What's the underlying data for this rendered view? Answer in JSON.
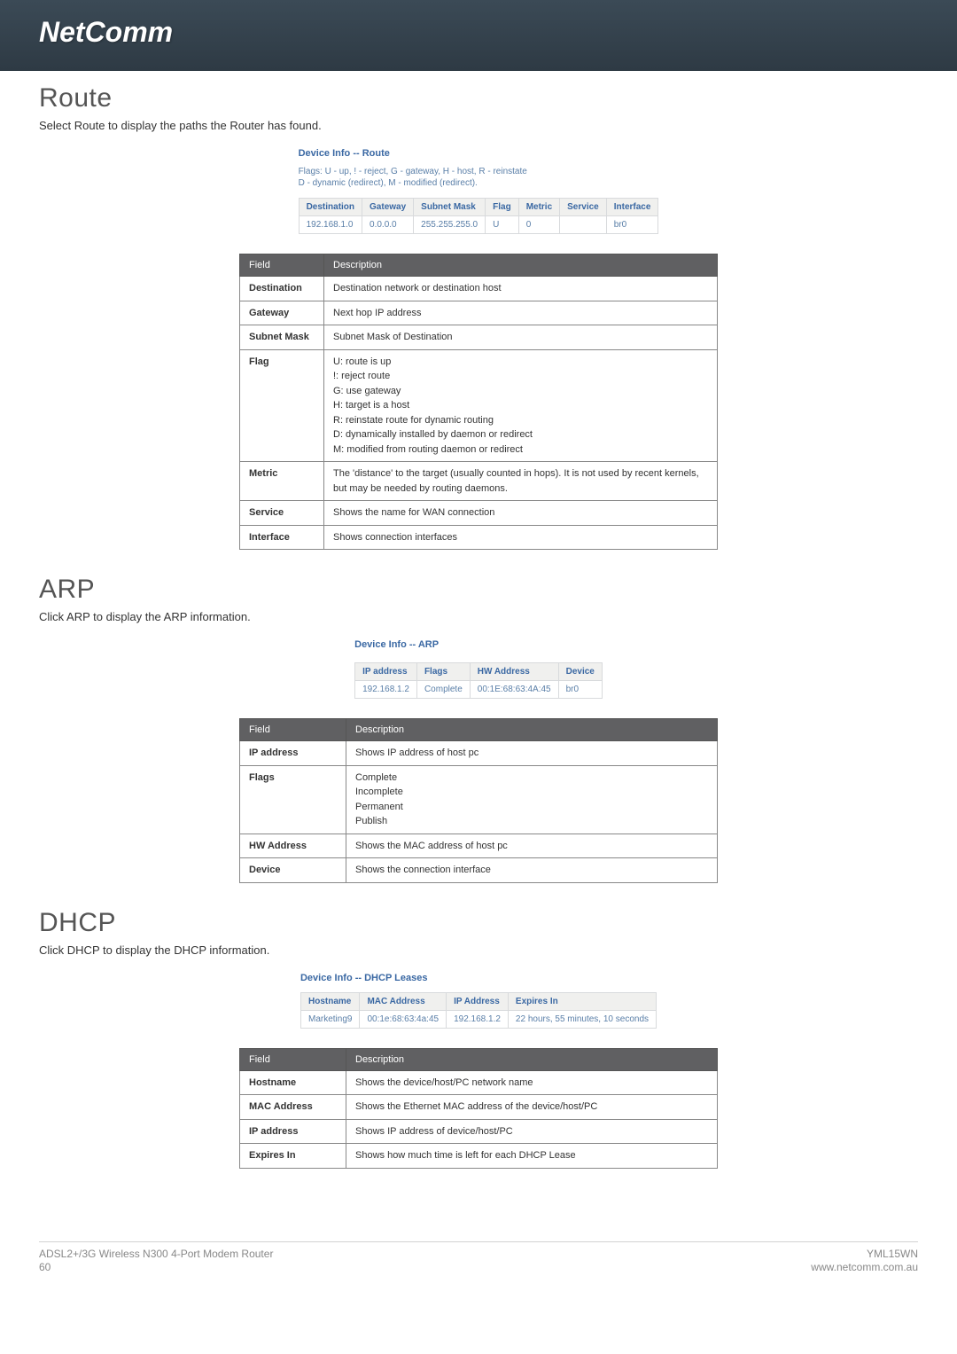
{
  "logo": "NetComm",
  "sections": {
    "route": {
      "title": "Route",
      "sub": "Select Route to display the paths the Router has found.",
      "deviceTitle": "Device Info -- Route",
      "note1": "Flags: U - up, ! - reject, G - gateway, H - host, R - reinstate",
      "note2": "D - dynamic (redirect), M - modified (redirect).",
      "screenshotHeaders": [
        "Destination",
        "Gateway",
        "Subnet Mask",
        "Flag",
        "Metric",
        "Service",
        "Interface"
      ],
      "screenshotRow": [
        "192.168.1.0",
        "0.0.0.0",
        "255.255.255.0",
        "U",
        "0",
        "",
        "br0"
      ],
      "docHeaders": [
        "Field",
        "Description"
      ],
      "rows": [
        {
          "f": "Destination",
          "d": "Destination network or destination host"
        },
        {
          "f": "Gateway",
          "d": "Next hop IP address"
        },
        {
          "f": "Subnet Mask",
          "d": "Subnet Mask of Destination"
        },
        {
          "f": "Flag",
          "d": "FLAGLIST"
        },
        {
          "f": "Metric",
          "d": "The 'distance' to the target (usually counted in hops). It is not used by recent kernels, but may be needed by routing daemons."
        },
        {
          "f": "Service",
          "d": "Shows the name for WAN connection"
        },
        {
          "f": "Interface",
          "d": "Shows connection interfaces"
        }
      ],
      "flagList": [
        "U: route is up",
        "!: reject route",
        "G: use gateway",
        "H: target is a host",
        "R: reinstate route for dynamic routing",
        "D: dynamically installed by daemon or redirect",
        "M: modified from routing daemon or redirect"
      ]
    },
    "arp": {
      "title": "ARP",
      "sub": "Click ARP to display the ARP information.",
      "deviceTitle": "Device Info -- ARP",
      "screenshotHeaders": [
        "IP address",
        "Flags",
        "HW Address",
        "Device"
      ],
      "screenshotRow": [
        "192.168.1.2",
        "Complete",
        "00:1E:68:63:4A:45",
        "br0"
      ],
      "docHeaders": [
        "Field",
        "Description"
      ],
      "rows": [
        {
          "f": "IP address",
          "d": "Shows IP address of host pc"
        },
        {
          "f": "Flags",
          "d": "FLAGS"
        },
        {
          "f": "HW Address",
          "d": "Shows the MAC address of host pc"
        },
        {
          "f": "Device",
          "d": "Shows the connection interface"
        }
      ],
      "flagsList": [
        "Complete",
        "Incomplete",
        "Permanent",
        "Publish"
      ]
    },
    "dhcp": {
      "title": "DHCP",
      "sub": "Click DHCP to display the DHCP information.",
      "deviceTitle": "Device Info -- DHCP Leases",
      "screenshotHeaders": [
        "Hostname",
        "MAC Address",
        "IP Address",
        "Expires In"
      ],
      "screenshotRow": [
        "Marketing9",
        "00:1e:68:63:4a:45",
        "192.168.1.2",
        "22 hours, 55 minutes, 10 seconds"
      ],
      "docHeaders": [
        "Field",
        "Description"
      ],
      "rows": [
        {
          "f": "Hostname",
          "d": "Shows the device/host/PC network name"
        },
        {
          "f": "MAC Address",
          "d": "Shows the Ethernet MAC address of the device/host/PC"
        },
        {
          "f": "IP address",
          "d": "Shows IP address of device/host/PC"
        },
        {
          "f": "Expires In",
          "d": "Shows how much time is left for each DHCP Lease"
        }
      ]
    }
  },
  "footer": {
    "leftLine1": "ADSL2+/3G Wireless N300 4-Port Modem Router",
    "leftLine2": "60",
    "rightLine1": "YML15WN",
    "rightLine2": "www.netcomm.com.au"
  }
}
